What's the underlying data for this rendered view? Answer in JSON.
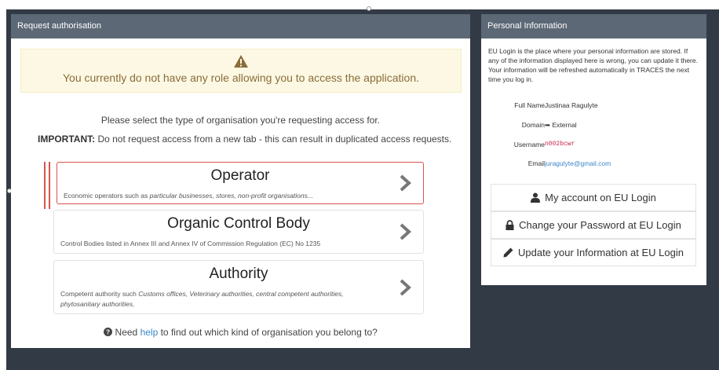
{
  "request_panel": {
    "title": "Request authorisation",
    "alert_text": "You currently do not have any role allowing you to access the application.",
    "intro": "Please select the type of organisation you're requesting access for.",
    "important_label": "IMPORTANT:",
    "important_text": " Do not request access from a new tab - this can result in duplicated access requests.",
    "options": [
      {
        "title": "Operator",
        "desc_plain": "Economic operators such as ",
        "desc_italic": "particular businesses, stores, non-profit organisations...",
        "selected": true
      },
      {
        "title": "Organic Control Body",
        "desc_plain": "Control Bodies listed in Annex III and Annex IV of Commission Regulation (EC) No 1235",
        "desc_italic": ""
      },
      {
        "title": "Authority",
        "desc_plain": "Competent authority such ",
        "desc_italic": "Customs offices, Veterinary authorities, central competent authorities, phytosanitary authorities,"
      }
    ],
    "help_pre": "Need ",
    "help_link": "help",
    "help_post": " to find out which kind of organisation you belong to?"
  },
  "personal_panel": {
    "title": "Personal Information",
    "description": "EU Login is the place where your personal information are stored. If any of the information displayed here is wrong, you can update it there. Your information will be refreshed automatically in TRACES the next time you log in.",
    "fields": {
      "full_name_label": "Full Name",
      "full_name_value": "Justinaa Ragulyte",
      "domain_label": "Domain",
      "domain_value": "External",
      "username_label": "Username",
      "username_value": "n002bcwr",
      "email_label": "Email",
      "email_value": "juragulyte@gmail.com"
    },
    "buttons": {
      "my_account": "My account on EU Login",
      "change_password": "Change your Password at EU Login",
      "update_info": "Update your Information at EU Login"
    }
  },
  "colors": {
    "panel_heading": "#5d6876",
    "background": "#323a45",
    "alert_bg": "#fcf8e3",
    "alert_text": "#8a6d3b",
    "selected_border": "#d9534f",
    "link": "#3a87c8"
  }
}
